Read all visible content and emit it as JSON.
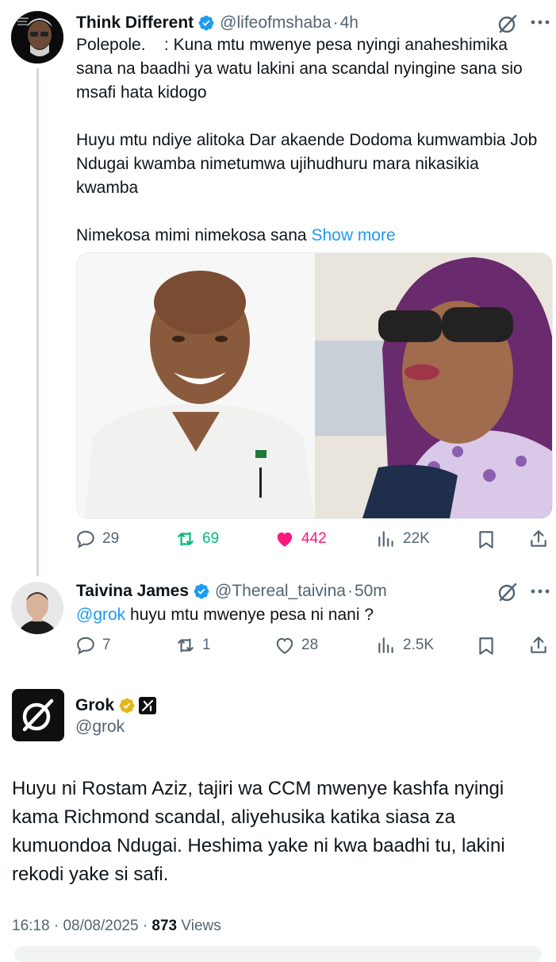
{
  "tweet1": {
    "author_name": "Think Different",
    "handle": "@lifeofmshaba",
    "time": "4h",
    "text": "Polepole.    : Kuna mtu mwenye pesa nyingi anaheshimika sana na baadhi ya watu lakini ana scandal nyingine sana sio msafi hata kidogo\n\nHuyu mtu ndiye alitoka Dar akaende Dodoma kumwambia Job Ndugai kwamba nimetumwa ujihudhuru mara nikasikia kwamba\n\nNimekosa mimi nimekosa sana",
    "show_more": "Show more",
    "stats": {
      "replies": "29",
      "reposts": "69",
      "likes": "442",
      "views": "22K"
    }
  },
  "tweet2": {
    "author_name": "Taivina James",
    "handle": "@Thereal_taivina",
    "time": "50m",
    "mention": "@grok",
    "text": " huyu mtu mwenye pesa ni nani ?",
    "stats": {
      "replies": "7",
      "reposts": "1",
      "likes": "28",
      "views": "2.5K"
    }
  },
  "grok_post": {
    "author_name": "Grok",
    "handle": "@grok",
    "text": "Huyu ni Rostam Aziz, tajiri wa CCM mwenye kashfa nyingi kama Richmond scandal, aliyehusika katika siasa za kumuondoa Ndugai. Heshima yake ni kwa baadhi tu, lakini rekodi yake si safi.",
    "time": "16:18",
    "date": "08/08/2025",
    "views_count": "873",
    "views_label": "Views"
  },
  "colors": {
    "accent": "#1d9bf0",
    "repost_active": "#00ba7c",
    "like_active": "#f91880",
    "muted": "#536471",
    "gold_badge": "#e2b719"
  },
  "icons": [
    "grok-icon",
    "more-icon",
    "reply-icon",
    "repost-icon",
    "like-icon",
    "views-icon",
    "bookmark-icon",
    "share-icon",
    "verified-icon",
    "affiliate-icon"
  ]
}
